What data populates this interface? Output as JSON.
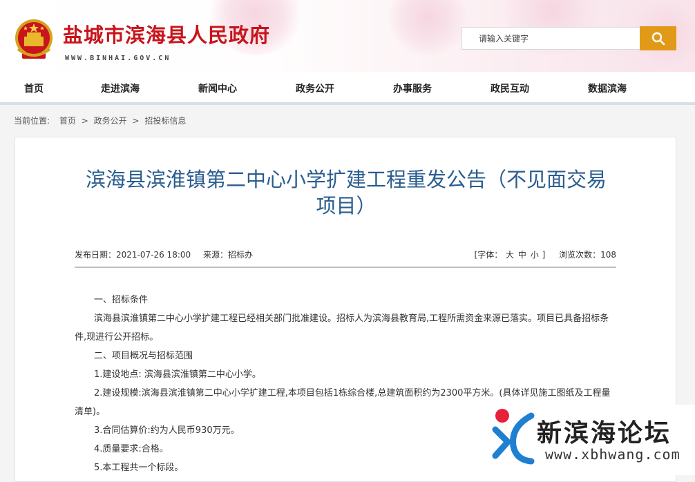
{
  "header": {
    "site_title": "盐城市滨海县人民政府",
    "site_url": "WWW.BINHAI.GOV.CN",
    "emblem_icon": "national-emblem-icon",
    "search": {
      "placeholder": "请输入关键字",
      "button_icon": "search-icon"
    },
    "colors": {
      "title": "#c8141b",
      "search_button": "#e19a18"
    }
  },
  "nav": {
    "items": [
      {
        "label": "首页"
      },
      {
        "label": "走进滨海"
      },
      {
        "label": "新闻中心"
      },
      {
        "label": "政务公开"
      },
      {
        "label": "办事服务"
      },
      {
        "label": "政民互动"
      },
      {
        "label": "数据滨海"
      }
    ]
  },
  "breadcrumb": {
    "prefix": "当前位置:",
    "items": [
      "首页",
      "政务公开",
      "招投标信息"
    ],
    "separator": ">"
  },
  "article": {
    "title": "滨海县滨淮镇第二中心小学扩建工程重发公告（不见面交易项目）",
    "title_color": "#2a5d8f",
    "meta": {
      "publish_date": "发布日期：2021-07-26 18:00",
      "source": "来源：招标办",
      "font_size_label": "[字体：",
      "font_size_options": [
        "大",
        "中",
        "小"
      ],
      "font_size_close": "]",
      "views": "浏览次数：108"
    },
    "paragraphs": [
      "一、招标条件",
      "滨海县滨淮镇第二中心小学扩建工程已经相关部门批准建设。招标人为滨海县教育局,工程所需资金来源已落实。项目已具备招标条件,现进行公开招标。",
      "二、项目概况与招标范围",
      "1.建设地点: 滨海县滨淮镇第二中心小学。",
      "2.建设规模:滨海县滨淮镇第二中心小学扩建工程,本项目包括1栋综合楼,总建筑面积约为2300平方米。(具体详见施工图纸及工程量清单)。",
      "3.合同估算价:约为人民币930万元。",
      "4.质量要求:合格。",
      "5.本工程共一个标段。"
    ]
  },
  "watermark": {
    "name": "新滨海论坛",
    "url": "www.xbhwang.com",
    "logo_icon": "xbhwang-logo-icon"
  }
}
